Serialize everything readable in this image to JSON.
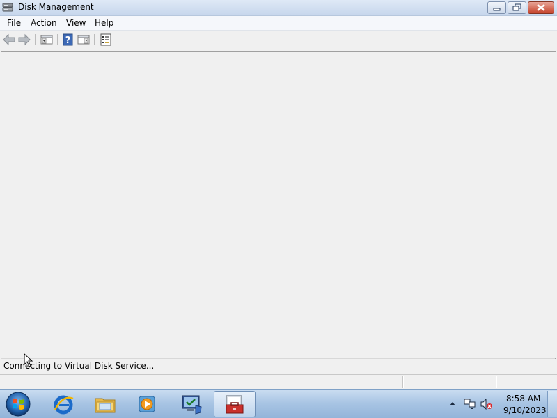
{
  "window": {
    "title": "Disk Management",
    "icon": "disk-management-icon",
    "caption_buttons": [
      "minimize",
      "maximize",
      "close"
    ]
  },
  "menu": {
    "items": [
      {
        "label": "File"
      },
      {
        "label": "Action"
      },
      {
        "label": "View"
      },
      {
        "label": "Help"
      }
    ]
  },
  "toolbar": {
    "buttons": [
      {
        "icon": "back-arrow-icon"
      },
      {
        "icon": "forward-arrow-icon"
      },
      {
        "icon": "show-hide-console-tree-icon"
      },
      {
        "icon": "help-icon"
      },
      {
        "icon": "show-hide-action-pane-icon"
      },
      {
        "icon": "properties-icon"
      }
    ]
  },
  "status": {
    "message": "Connecting to Virtual Disk Service..."
  },
  "taskbar": {
    "pinned": [
      {
        "icon": "internet-explorer-icon"
      },
      {
        "icon": "windows-explorer-icon"
      },
      {
        "icon": "media-player-icon"
      },
      {
        "icon": "server-manager-icon"
      },
      {
        "icon": "computer-management-icon",
        "active": true
      }
    ],
    "tray_icons": [
      "show-hidden-icons-arrow",
      "network-icon",
      "volume-muted-icon"
    ],
    "clock": {
      "time": "8:58 AM",
      "date": "9/10/2023"
    }
  },
  "colors": {
    "titlebar": "#c6d6ec",
    "window_bg": "#f0f0f0",
    "close_button": "#c5432b",
    "taskbar": "#a9c5e4"
  }
}
